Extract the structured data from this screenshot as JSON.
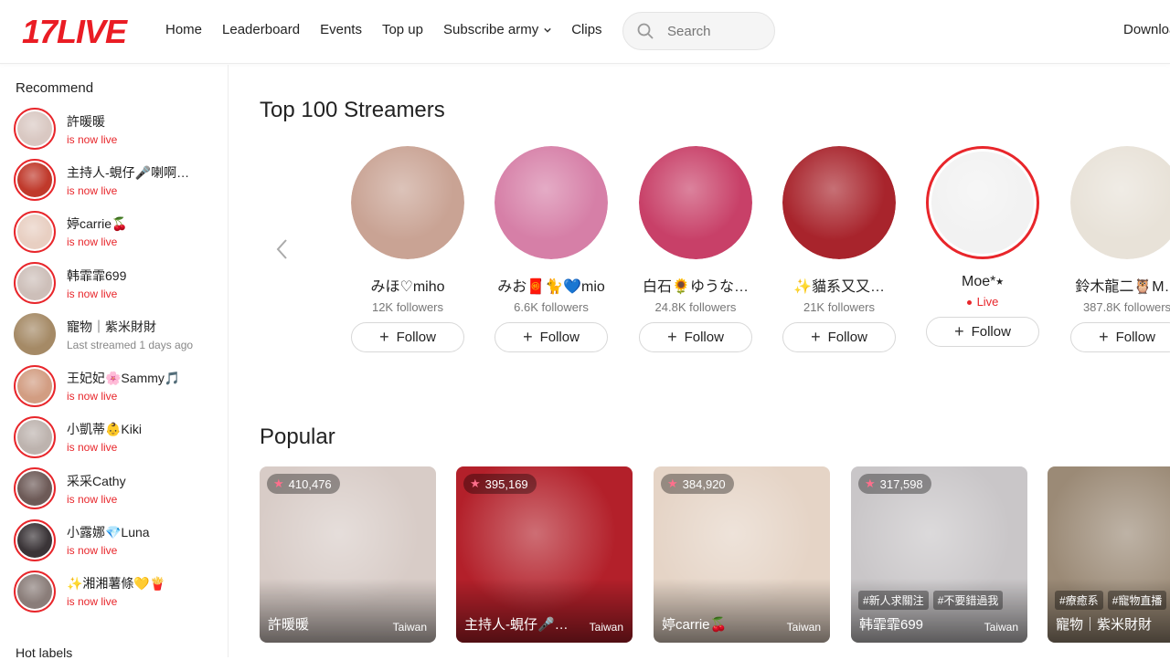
{
  "header": {
    "logo": "17LIVE",
    "nav": [
      "Home",
      "Leaderboard",
      "Events",
      "Top up",
      "Subscribe army",
      "Clips"
    ],
    "search_placeholder": "Search",
    "download": "Download"
  },
  "sidebar": {
    "title": "Recommend",
    "items": [
      {
        "name": "許暖暖",
        "status": "is now live",
        "live": true,
        "color": "#d9c8c2"
      },
      {
        "name": "主持人-蜆仔🎤喇啊…",
        "status": "is now live",
        "live": true,
        "color": "#c0392b"
      },
      {
        "name": "婷carrie🍒",
        "status": "is now live",
        "live": true,
        "color": "#e8cfc2"
      },
      {
        "name": "韩霏霏699",
        "status": "is now live",
        "live": true,
        "color": "#cdbfb9"
      },
      {
        "name": "寵物｜紫米財財",
        "status": "Last streamed 1 days ago",
        "live": false,
        "color": "#a58a66"
      },
      {
        "name": "王妃妃🌸Sammy🎵",
        "status": "is now live",
        "live": true,
        "color": "#d29d82"
      },
      {
        "name": "小凱蒂👶Kiki",
        "status": "is now live",
        "live": true,
        "color": "#bdb3ae"
      },
      {
        "name": "采采Cathy",
        "status": "is now live",
        "live": true,
        "color": "#6d5a57"
      },
      {
        "name": "小露娜💎Luna",
        "status": "is now live",
        "live": true,
        "color": "#3a3437"
      },
      {
        "name": "✨湘湘薯條💛🍟",
        "status": "is now live",
        "live": true,
        "color": "#8a7d79"
      }
    ],
    "hot_labels": "Hot labels"
  },
  "main": {
    "top_title": "Top 100 Streamers",
    "follow_label": "Follow",
    "streamers": [
      {
        "name": "みほ♡miho",
        "followers": "12K followers",
        "live": false,
        "color": "#c9a394"
      },
      {
        "name": "みお🧧🐈💙mio",
        "followers": "6.6K followers",
        "live": false,
        "color": "#d67fa7"
      },
      {
        "name": "白石🌻ゆうな…",
        "followers": "24.8K followers",
        "live": false,
        "color": "#c84068"
      },
      {
        "name": "✨貓系又又…",
        "followers": "21K followers",
        "live": false,
        "color": "#a8242c"
      },
      {
        "name": "Moe*⭑",
        "followers": "Live",
        "live": true,
        "color": "#f2f2f2"
      },
      {
        "name": "鈴木龍二🦉M…",
        "followers": "387.8K followers",
        "live": false,
        "color": "#e8e2d8"
      }
    ],
    "popular_title": "Popular",
    "cards": [
      {
        "viewers": "410,476",
        "name": "許暖暖",
        "region": "Taiwan",
        "tags": [],
        "color": "#d8ccc7"
      },
      {
        "viewers": "395,169",
        "name": "主持人-蜆仔🎤…",
        "region": "Taiwan",
        "tags": [],
        "color": "#b3202a"
      },
      {
        "viewers": "384,920",
        "name": "婷carrie🍒",
        "region": "Taiwan",
        "tags": [],
        "color": "#e5d4c6"
      },
      {
        "viewers": "317,598",
        "name": "韩霏霏699",
        "region": "Taiwan",
        "tags": [
          "#新人求關注",
          "#不要錯過我"
        ],
        "color": "#c9c6c8"
      },
      {
        "viewers": "",
        "name": "寵物｜紫米財財",
        "region": "",
        "tags": [
          "#療癒系",
          "#寵物直播"
        ],
        "color": "#9b8a76"
      }
    ]
  },
  "colors": {
    "brand": "#ea1c24",
    "live": "#e8262b"
  }
}
